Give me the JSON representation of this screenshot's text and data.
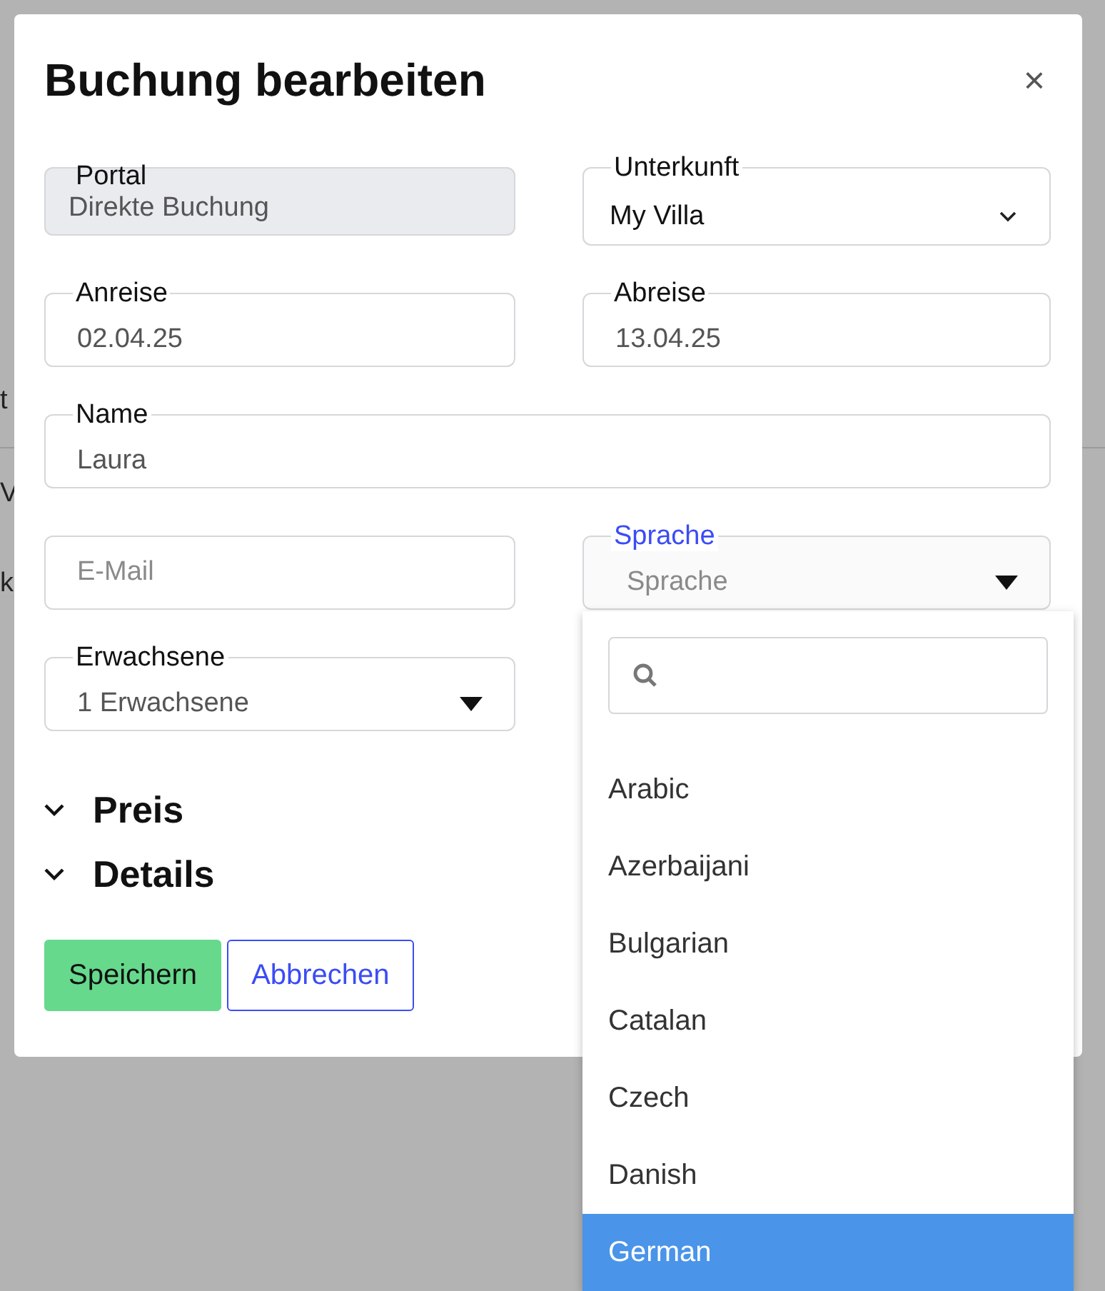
{
  "background_texts": [
    "t",
    "V",
    "k"
  ],
  "dialog": {
    "title": "Buchung bearbeiten",
    "close": "×"
  },
  "field_rows": [
    [
      {
        "label": "Portal",
        "value": "Direkte Buchung",
        "kind": "readonly"
      },
      {
        "label": "Unterkunft",
        "value": "My Villa",
        "kind": "select"
      }
    ],
    [
      {
        "label": "Anreise",
        "value": "02.04.25",
        "kind": "text"
      },
      {
        "label": "Abreise",
        "value": "13.04.25",
        "kind": "text"
      }
    ],
    [
      {
        "label": "Name",
        "value": "Laura",
        "kind": "text",
        "full_width": true
      }
    ],
    [
      {
        "placeholder": "E-Mail",
        "kind": "text"
      },
      {
        "label": "Sprache",
        "placeholder": "Sprache",
        "kind": "dropdown",
        "focused": true
      }
    ],
    [
      {
        "label": "Erwachsene",
        "value": "1 Erwachsene",
        "kind": "dropdown"
      }
    ]
  ],
  "sections": [
    {
      "label": "Preis",
      "expanded": false
    },
    {
      "label": "Details",
      "expanded": false
    }
  ],
  "buttons": [
    {
      "label": "Speichern",
      "kind": "primary"
    },
    {
      "label": "Abbrechen",
      "kind": "secondary"
    }
  ],
  "language_menu": {
    "options": [
      {
        "label": "Arabic",
        "selected": false
      },
      {
        "label": "Azerbaijani",
        "selected": false
      },
      {
        "label": "Bulgarian",
        "selected": false
      },
      {
        "label": "Catalan",
        "selected": false
      },
      {
        "label": "Czech",
        "selected": false
      },
      {
        "label": "Danish",
        "selected": false
      },
      {
        "label": "German",
        "selected": true
      }
    ]
  }
}
